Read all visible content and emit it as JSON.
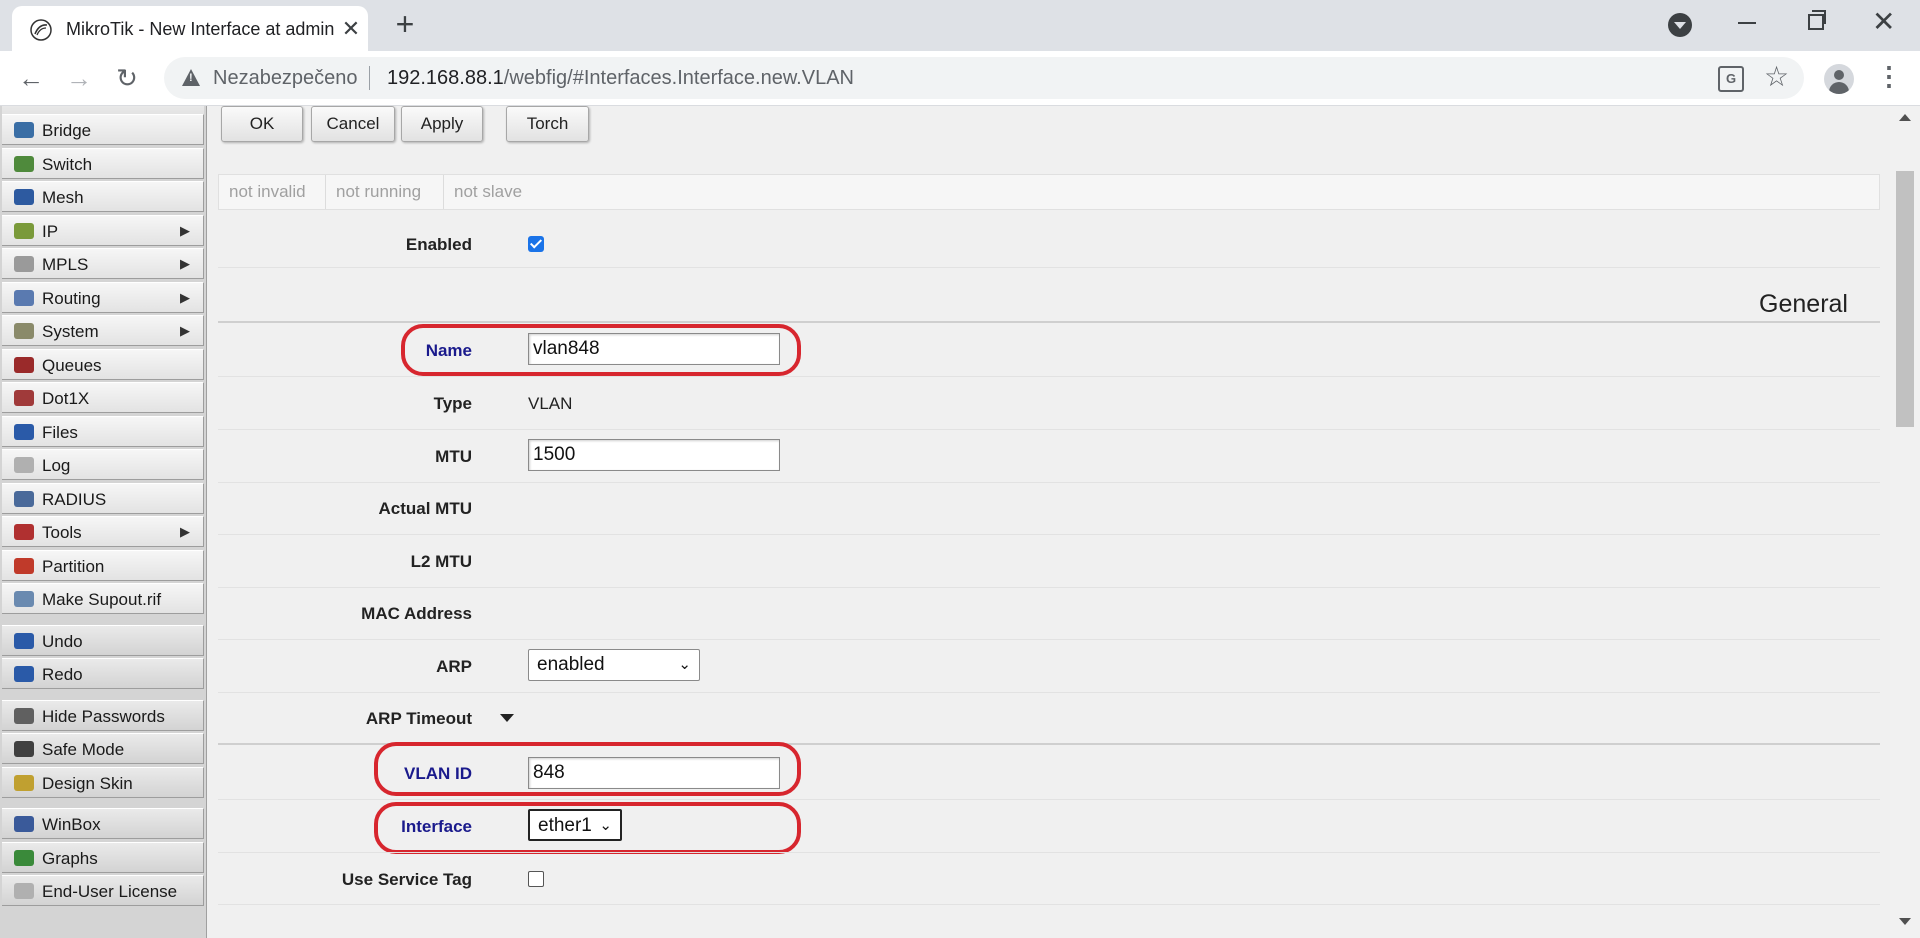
{
  "browser": {
    "tab_title": "MikroTik - New Interface at admin",
    "tab_close": "✕",
    "new_tab": "+",
    "security_label": "Nezabezpečeno",
    "url_host": "192.168.88.1",
    "url_path": "/webfig/#Interfaces.Interface.new.VLAN",
    "icons": [
      "mikrotik-favicon",
      "tab-search-icon",
      "minimize-icon",
      "maximize-icon",
      "close-window-icon",
      "back-icon",
      "forward-icon",
      "reload-icon",
      "not-secure-icon",
      "translate-icon",
      "bookmark-star-icon",
      "profile-icon",
      "kebab-menu-icon"
    ]
  },
  "sidebar": {
    "items": [
      {
        "label": "Bridge",
        "icon": "bridge-icon",
        "color": "#3a6ea5",
        "arrow": ""
      },
      {
        "label": "Switch",
        "icon": "switch-icon",
        "color": "#4f8a3c",
        "arrow": ""
      },
      {
        "label": "Mesh",
        "icon": "mesh-icon",
        "color": "#2d5aa0",
        "arrow": ""
      },
      {
        "label": "IP",
        "icon": "ip-icon",
        "color": "#7a9a3a",
        "arrow": "▶"
      },
      {
        "label": "MPLS",
        "icon": "mpls-icon",
        "color": "#9a9a9a",
        "arrow": "▶"
      },
      {
        "label": "Routing",
        "icon": "routing-icon",
        "color": "#5a7ab0",
        "arrow": "▶"
      },
      {
        "label": "System",
        "icon": "system-icon",
        "color": "#8a8a6a",
        "arrow": "▶"
      },
      {
        "label": "Queues",
        "icon": "queues-icon",
        "color": "#9a2a2a",
        "arrow": ""
      },
      {
        "label": "Dot1X",
        "icon": "dot1x-icon",
        "color": "#a03a3a",
        "arrow": ""
      },
      {
        "label": "Files",
        "icon": "files-icon",
        "color": "#2a5aa8",
        "arrow": ""
      },
      {
        "label": "Log",
        "icon": "log-icon",
        "color": "#b0b0b0",
        "arrow": ""
      },
      {
        "label": "RADIUS",
        "icon": "radius-icon",
        "color": "#4a6a9a",
        "arrow": ""
      },
      {
        "label": "Tools",
        "icon": "tools-icon",
        "color": "#b03030",
        "arrow": "▶"
      },
      {
        "label": "Partition",
        "icon": "partition-icon",
        "color": "#c03a2a",
        "arrow": ""
      },
      {
        "label": "Make Supout.rif",
        "icon": "supout-icon",
        "color": "#6a8ab0",
        "arrow": ""
      },
      {
        "label": "Undo",
        "icon": "undo-icon",
        "color": "#2a5aa8",
        "arrow": ""
      },
      {
        "label": "Redo",
        "icon": "redo-icon",
        "color": "#2a5aa8",
        "arrow": ""
      },
      {
        "label": "Hide Passwords",
        "icon": "hide-passwords-icon",
        "color": "#606060",
        "arrow": ""
      },
      {
        "label": "Safe Mode",
        "icon": "safe-mode-icon",
        "color": "#404040",
        "arrow": ""
      },
      {
        "label": "Design Skin",
        "icon": "design-skin-icon",
        "color": "#c0a030",
        "arrow": ""
      },
      {
        "label": "WinBox",
        "icon": "winbox-icon",
        "color": "#3a5a9a",
        "arrow": ""
      },
      {
        "label": "Graphs",
        "icon": "graphs-icon",
        "color": "#3a8a3a",
        "arrow": ""
      },
      {
        "label": "End-User License",
        "icon": "license-icon",
        "color": "#b0b0b0",
        "arrow": ""
      }
    ]
  },
  "toolbar": {
    "ok": "OK",
    "cancel": "Cancel",
    "apply": "Apply",
    "torch": "Torch"
  },
  "status": [
    "not invalid",
    "not running",
    "not slave"
  ],
  "form": {
    "enabled_label": "Enabled",
    "enabled_value": true,
    "section_general": "General",
    "name_label": "Name",
    "name_value": "vlan848",
    "type_label": "Type",
    "type_value": "VLAN",
    "mtu_label": "MTU",
    "mtu_value": "1500",
    "actual_mtu_label": "Actual MTU",
    "l2_mtu_label": "L2 MTU",
    "mac_label": "MAC Address",
    "arp_label": "ARP",
    "arp_value": "enabled",
    "arp_timeout_label": "ARP Timeout",
    "vlan_id_label": "VLAN ID",
    "vlan_id_value": "848",
    "interface_label": "Interface",
    "interface_value": "ether1",
    "service_tag_label": "Use Service Tag",
    "service_tag_value": false
  },
  "colors": {
    "highlight": "#d7262e",
    "accent_label": "#1a1a8c",
    "checkbox": "#1a73e8"
  }
}
